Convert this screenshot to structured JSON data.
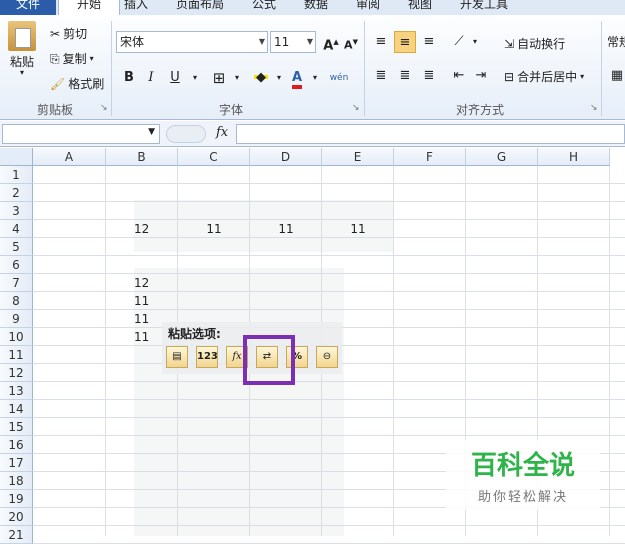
{
  "tabs": [
    "文件",
    "开始",
    "插入",
    "页面布局",
    "公式",
    "数据",
    "审阅",
    "视图",
    "开发工具"
  ],
  "clipboard": {
    "paste_label": "粘贴",
    "cut_label": "剪切",
    "copy_label": "复制",
    "format_painter_label": "格式刷",
    "group_label": "剪贴板"
  },
  "font": {
    "name": "宋体",
    "size": "11",
    "group_label": "字体",
    "bold": "B",
    "italic": "I",
    "underline": "U",
    "grow": "A",
    "shrink": "A",
    "phonetic": "wén"
  },
  "alignment": {
    "wrap_label": "自动换行",
    "merge_label": "合并后居中",
    "group_label": "对齐方式"
  },
  "number": {
    "format_label": "常规"
  },
  "formula_bar": {
    "fx": "fx",
    "name_box": ""
  },
  "columns": [
    "A",
    "B",
    "C",
    "D",
    "E",
    "F",
    "G",
    "H"
  ],
  "rows": [
    "1",
    "2",
    "3",
    "4",
    "5",
    "6",
    "7",
    "8",
    "9",
    "10",
    "11",
    "12",
    "13",
    "14",
    "15",
    "16",
    "17",
    "18",
    "19",
    "20",
    "21"
  ],
  "cells": {
    "B4": "12",
    "C4": "11",
    "D4": "11",
    "E4": "11",
    "B7": "12",
    "B8": "11",
    "B9": "11",
    "B10": "11"
  },
  "paste_options": {
    "title": "粘贴选项:",
    "icons": [
      "paste-icon",
      "values-icon",
      "formulas-icon",
      "transpose-icon",
      "formatting-icon",
      "link-icon"
    ],
    "icon_text": [
      "",
      "123",
      "fx",
      "",
      "%",
      ""
    ]
  },
  "watermark": {
    "title": "百科全说",
    "subtitle": "助你轻松解决"
  },
  "colors": {
    "accent": "#2a5caa",
    "highlight": "#7b2fb5",
    "watermark_green": "#2fb34a"
  }
}
